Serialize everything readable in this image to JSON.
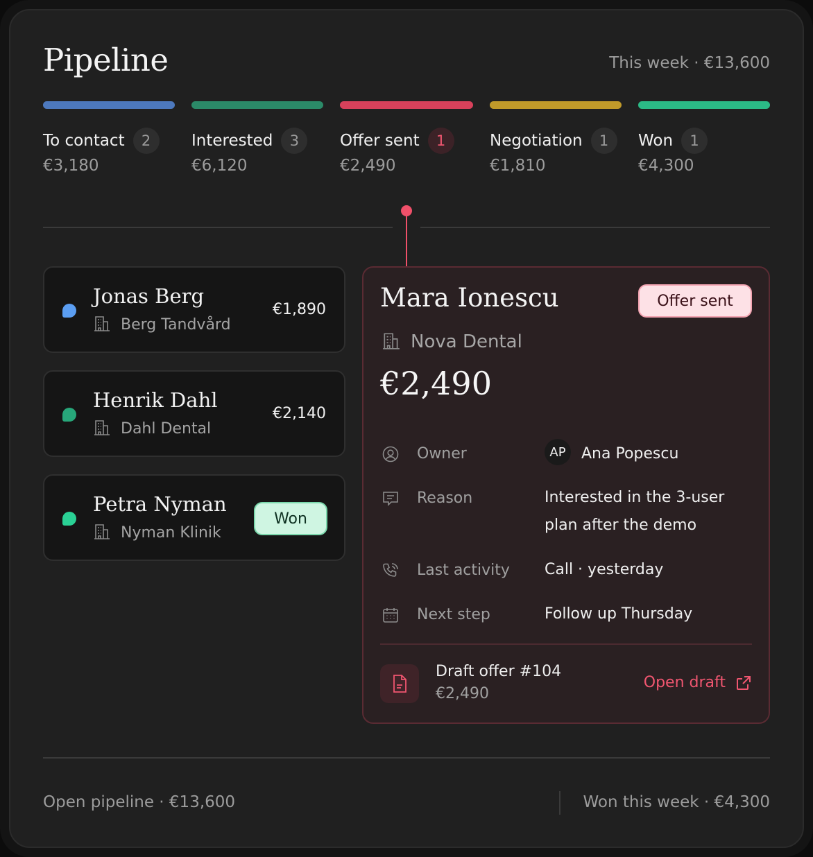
{
  "header": {
    "title": "Pipeline",
    "summary": "This week · €13,600"
  },
  "stages": [
    {
      "label": "To contact",
      "count": "2",
      "amount": "€3,180",
      "color": "#4d79be"
    },
    {
      "label": "Interested",
      "count": "3",
      "amount": "€6,120",
      "color": "#2b8a68"
    },
    {
      "label": "Offer sent",
      "count": "1",
      "amount": "€2,490",
      "color": "#d8415b"
    },
    {
      "label": "Negotiation",
      "count": "1",
      "amount": "€1,810",
      "color": "#c09a2a"
    },
    {
      "label": "Won",
      "count": "1",
      "amount": "€4,300",
      "color": "#2bba86"
    }
  ],
  "deals": [
    {
      "name": "Jonas Berg",
      "company": "Berg Tandvård",
      "amount": "€1,890",
      "color": "#5b9ef2"
    },
    {
      "name": "Henrik Dahl",
      "company": "Dahl Dental",
      "amount": "€2,140",
      "color": "#27a77a"
    },
    {
      "name": "Petra Nyman",
      "company": "Nyman Klinik",
      "badge": "Won",
      "color": "#2ad195"
    }
  ],
  "detail": {
    "name": "Mara Ionescu",
    "status": "Offer sent",
    "company": "Nova Dental",
    "amount": "€2,490",
    "fields": {
      "owner": {
        "label": "Owner",
        "initials": "AP",
        "value": "Ana Popescu"
      },
      "reason": {
        "label": "Reason",
        "value": "Interested in the 3-user plan after the demo"
      },
      "last_activity": {
        "label": "Last activity",
        "value": "Call · yesterday"
      },
      "next_step": {
        "label": "Next step",
        "value": "Follow up Thursday"
      }
    },
    "draft": {
      "title": "Draft offer #104",
      "amount": "€2,490",
      "action": "Open draft"
    }
  },
  "footer": {
    "open_pipeline": "Open pipeline · €13,600",
    "won_this_week": "Won this week · €4,300"
  },
  "colors": {
    "accent": "#f05670",
    "won_badge_bg": "#cff5e2",
    "offer_badge_bg": "#fde1e6"
  }
}
